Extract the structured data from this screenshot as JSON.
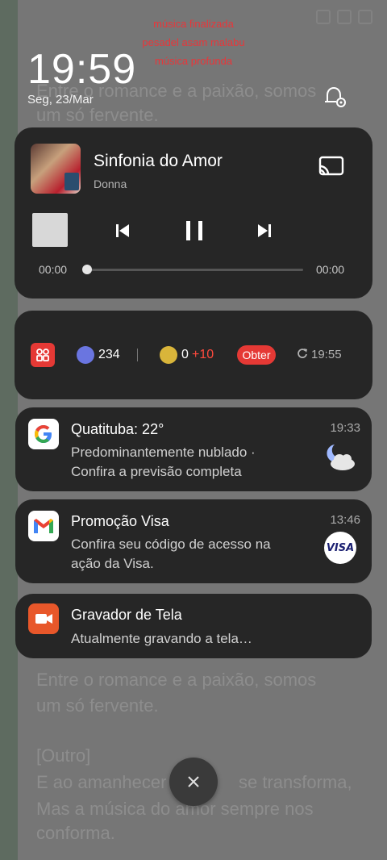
{
  "overlay": {
    "line1": "música finalizada",
    "line2": "pesadel asam malabu",
    "line3": "música profunda"
  },
  "lockscreen": {
    "time": "19:59",
    "date": "Seg, 23/Mar"
  },
  "background_lyrics": [
    "Entre o romance e a paixão, somos",
    "um só fervente.",
    "Entre o romance e a paixão, somos",
    "um só fervente.",
    "[Outro]",
    "E ao amanhecer",
    "se transforma,",
    "Mas a música do amor sempre nos",
    "conforma."
  ],
  "media": {
    "title": "Sinfonia do Amor",
    "artist": "Donna",
    "elapsed": "00:00",
    "duration": "00:00",
    "progress": 0
  },
  "rewards": {
    "steps": "234",
    "coins": "0",
    "bonus": "+10",
    "action": "Obter",
    "updated": "19:55"
  },
  "notifications": [
    {
      "app": "google",
      "title": "Quatituba: 22°",
      "time": "19:33",
      "line1": "Predominantemente nublado ·",
      "line2": "Confira a previsão completa",
      "thumb": "weather-partly-cloudy-night-icon"
    },
    {
      "app": "gmail",
      "title": "Promoção Visa",
      "time": "13:46",
      "line1": "Confira seu código de acesso na",
      "line2": "ação da Visa.",
      "thumb_text": "VISA"
    },
    {
      "app": "screen-recorder",
      "title": "Gravador de Tela",
      "time": "",
      "line1": "Atualmente gravando a tela…",
      "line2": ""
    }
  ],
  "colors": {
    "card": "#262626",
    "accent_red": "#e53935",
    "bonus_red": "#ff4a3d",
    "recorder_orange": "#e8572a"
  }
}
